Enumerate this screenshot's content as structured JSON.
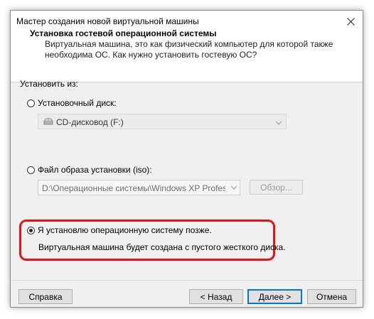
{
  "window": {
    "title": "Мастер создания новой виртуальной машины"
  },
  "header": {
    "title": "Установка гостевой операционной системы",
    "subtitle_line1": "Виртуальная машина, это как физический компьютер для которой также",
    "subtitle_line2": "необходима ОС. Как нужно установить гостевую ОС?"
  },
  "install_from": {
    "label": "Установить из:",
    "options": [
      {
        "label": "Установочный диск:",
        "selected": false
      },
      {
        "label": "Файл образа установки (iso):",
        "selected": false
      },
      {
        "label": "Я установлю операционную систему позже.",
        "selected": true
      }
    ],
    "disc_drive": "CD-дисковод (F:)",
    "iso_path": "D:\\Операционные системы\\Windows XP Professional",
    "browse_label": "Обзор...",
    "later_description": "Виртуальная машина будет создана с пустого жесткого диска."
  },
  "footer": {
    "help_label": "Справка",
    "back_label": "< Назад",
    "next_label": "Далее >",
    "cancel_label": "Отмена"
  },
  "colors": {
    "highlight": "#e8121a",
    "default_button_border": "#0078d7",
    "dialog_background": "#f0f0f0"
  },
  "icons": [
    "close-icon",
    "cd-drive-icon",
    "chevron-down-icon"
  ]
}
